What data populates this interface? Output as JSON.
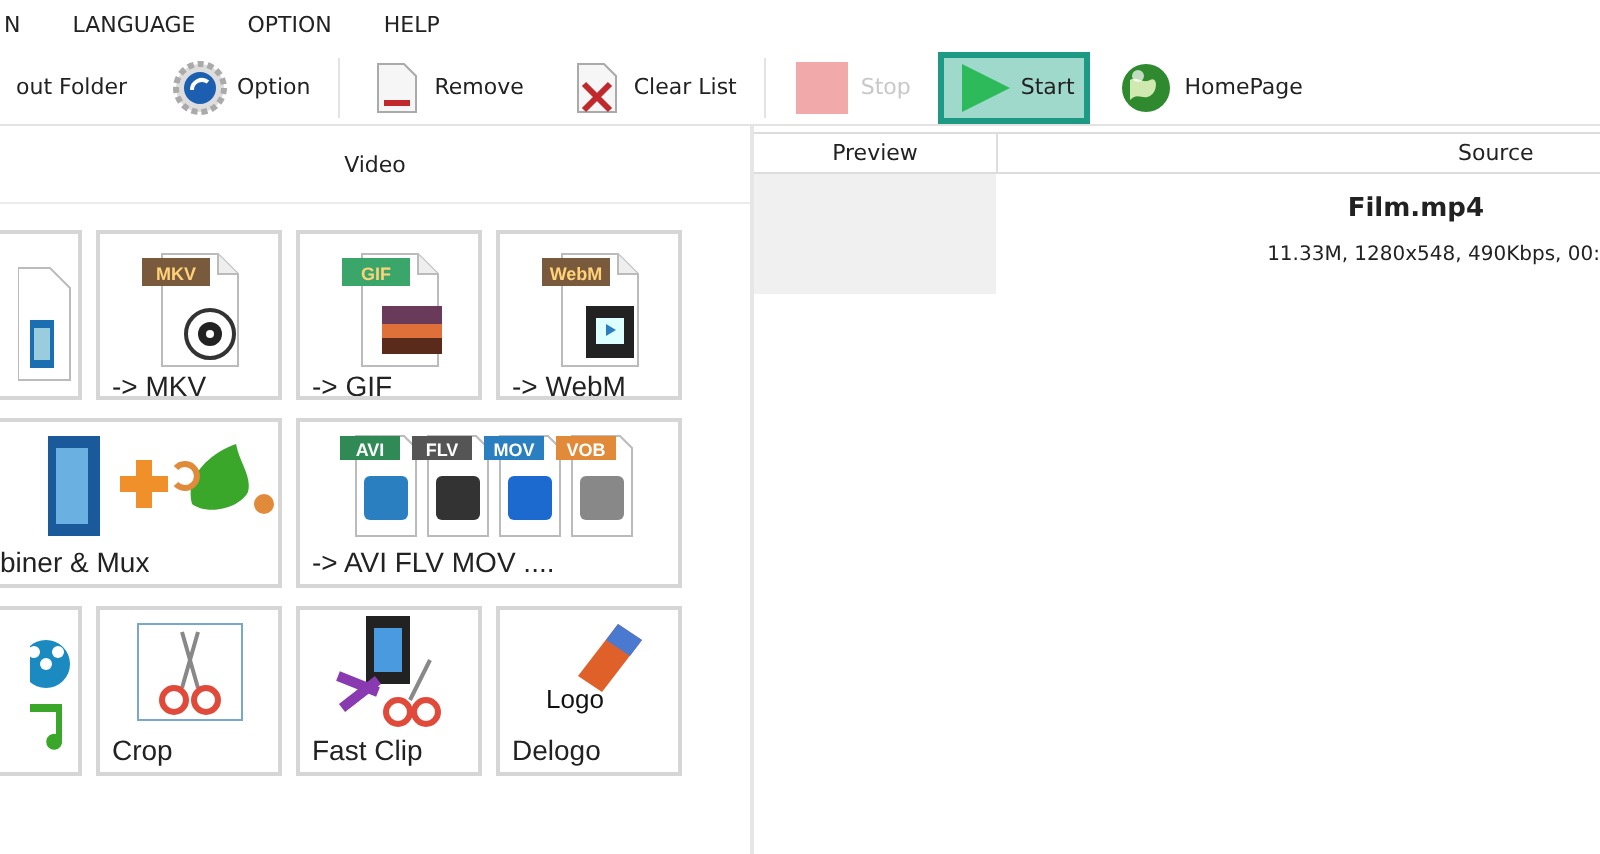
{
  "menu": [
    {
      "label": "N"
    },
    {
      "label": "LANGUAGE"
    },
    {
      "label": "OPTION"
    },
    {
      "label": "HELP"
    }
  ],
  "toolbar": {
    "groups": [
      [
        {
          "label": "out Folder",
          "kind": "text",
          "disabled": false,
          "highlighted": false
        },
        {
          "label": "Option",
          "kind": "gear",
          "disabled": false,
          "highlighted": false
        }
      ],
      [
        {
          "label": "Remove",
          "kind": "remove",
          "disabled": false,
          "highlighted": false
        },
        {
          "label": "Clear List",
          "kind": "clear",
          "disabled": false,
          "highlighted": false
        }
      ],
      [
        {
          "label": "Stop",
          "kind": "stop",
          "disabled": true,
          "highlighted": false
        },
        {
          "label": "Start",
          "kind": "start",
          "disabled": false,
          "highlighted": true
        },
        {
          "label": "HomePage",
          "kind": "globe",
          "disabled": false,
          "highlighted": false
        }
      ]
    ]
  },
  "left_panel": {
    "title": "Video",
    "tiles": [
      {
        "kind": "filestub"
      },
      {
        "kind": "disc",
        "label": "-> MKV",
        "badges": [
          {
            "text": "MKV",
            "color": "#7a5a3c"
          }
        ]
      },
      {
        "kind": "sunset",
        "label": "-> GIF",
        "badges": [
          {
            "text": "GIF",
            "color": "#3aa66a"
          }
        ]
      },
      {
        "kind": "film",
        "label": "-> WebM",
        "badges": [
          {
            "text": "WebM",
            "color": "#7a5a3c"
          }
        ]
      },
      {
        "kind": "mux",
        "label": "biner & Mux"
      },
      {
        "kind": "multi",
        "label": "-> AVI FLV MOV ....",
        "badges": [
          {
            "text": "AVI",
            "color": "#2f8a55"
          },
          {
            "text": "FLV",
            "color": "#555555"
          },
          {
            "text": "MOV",
            "color": "#2a7fc0"
          },
          {
            "text": "VOB",
            "color": "#e08a3a"
          }
        ]
      },
      {
        "kind": "reelstub"
      },
      {
        "kind": "crop",
        "label": "Crop"
      },
      {
        "kind": "fastclip",
        "label": "Fast Clip"
      },
      {
        "kind": "delogo",
        "label": "Delogo",
        "icon_text": "Logo"
      }
    ]
  },
  "file_list": {
    "columns": [
      "Preview",
      "Source"
    ],
    "rows": [
      {
        "name": "Film.mp4",
        "info": "11.33M, 1280x548, 490Kbps, 00:"
      }
    ]
  }
}
